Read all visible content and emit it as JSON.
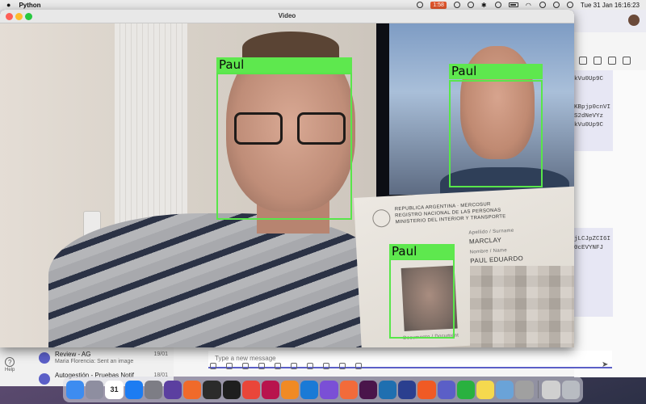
{
  "menubar": {
    "app_name": "Python",
    "recorder_pill": "1:58",
    "date_time": "Tue 31 Jan  16:16:23"
  },
  "video_window": {
    "title": "Video",
    "detections": [
      {
        "label": "Paul"
      },
      {
        "label": "Paul"
      },
      {
        "label": "Paul"
      }
    ],
    "id_card": {
      "line1": "REPUBLICA ARGENTINA · MERCOSUR",
      "line2": "REGISTRO NACIONAL DE LAS PERSONAS",
      "line3": "MINISTERIO DEL INTERIOR Y TRANSPORTE",
      "surname_label": "Apellido / Surname",
      "surname": "MARCLAY",
      "name_label": "Nombre / Name",
      "name": "PAUL EDUARDO",
      "doc_label": "Documento / Document"
    }
  },
  "teams": {
    "tokens": [
      "kVu0Up9C",
      "KBpjp0cnVI",
      "S2dNeVYz",
      "kVu0Up9C",
      "jLCJpZCI6I",
      "0cEVYNFJ"
    ],
    "help_label": "Help",
    "chats": [
      {
        "title": "Review - AG",
        "subtitle": "Maria Florencia: Sent an image",
        "date": "19/01"
      },
      {
        "title": "Autogestión - Pruebas Notif",
        "subtitle": "",
        "date": "18/01"
      }
    ],
    "compose_placeholder": "Type a new message"
  },
  "colors": {
    "detection_box": "#58e64a",
    "detection_label_bg": "#5ee84e",
    "teams_accent": "#5b5fc7"
  },
  "dock": {
    "apps": [
      {
        "name": "finder-icon",
        "color": "#3d8cf0"
      },
      {
        "name": "launchpad-icon",
        "color": "#8e8ea0"
      },
      {
        "name": "calendar-icon",
        "color": "#ffffff",
        "text": "31"
      },
      {
        "name": "app-store-icon",
        "color": "#1c7cf2"
      },
      {
        "name": "system-settings-icon",
        "color": "#7d7d85"
      },
      {
        "name": "feather-app-icon",
        "color": "#5b3fa0"
      },
      {
        "name": "orange-app-icon",
        "color": "#f06a2a"
      },
      {
        "name": "terminal-icon",
        "color": "#2b2b2b"
      },
      {
        "name": "terminal-2-icon",
        "color": "#1e1e1e"
      },
      {
        "name": "chrome-icon",
        "color": "#e9463a"
      },
      {
        "name": "rubymine-icon",
        "color": "#b8134d"
      },
      {
        "name": "sublime-icon",
        "color": "#f08a24"
      },
      {
        "name": "vscode-icon",
        "color": "#1a7ad6"
      },
      {
        "name": "github-desktop-icon",
        "color": "#7a4fd6"
      },
      {
        "name": "postman-icon",
        "color": "#f26b3a"
      },
      {
        "name": "slack-icon",
        "color": "#4a154b"
      },
      {
        "name": "navigator-icon",
        "color": "#1f6fb0"
      },
      {
        "name": "network-app-icon",
        "color": "#2a3f8f"
      },
      {
        "name": "brave-icon",
        "color": "#f05a24"
      },
      {
        "name": "teams-icon",
        "color": "#5b5fc7"
      },
      {
        "name": "whatsapp-icon",
        "color": "#29b13f"
      },
      {
        "name": "notes-icon",
        "color": "#f5d94e"
      },
      {
        "name": "preview-icon",
        "color": "#6aa3d8"
      },
      {
        "name": "pen-app-icon",
        "color": "#a0a0a0"
      },
      {
        "name": "document-icon",
        "color": "#d0d0d0"
      },
      {
        "name": "trash-icon",
        "color": "#b8bcc2"
      }
    ]
  }
}
